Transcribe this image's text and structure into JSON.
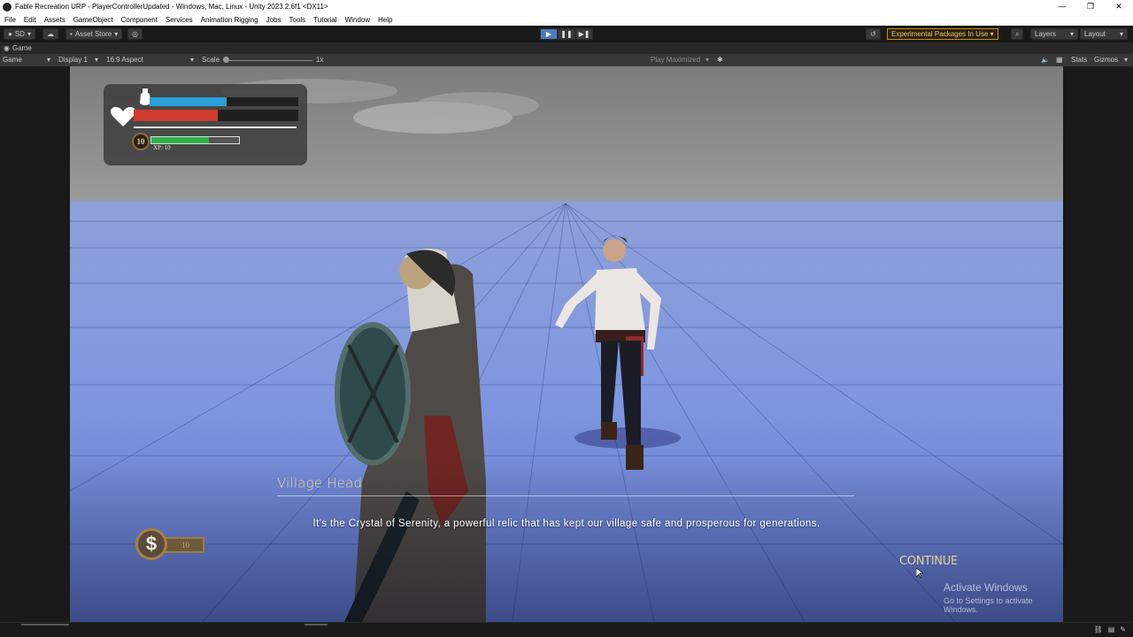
{
  "window": {
    "title": "Fable Recreation URP - PlayerControllerUpdated - Windows, Mac, Linux - Unity 2023.2.6f1 <DX11>",
    "controls": [
      "—",
      "❐",
      "✕"
    ]
  },
  "menu": [
    "File",
    "Edit",
    "Assets",
    "GameObject",
    "Component",
    "Services",
    "Animation Rigging",
    "Jobs",
    "Tools",
    "Tutorial",
    "Window",
    "Help"
  ],
  "toolbar": {
    "account": "SD",
    "asset_store": "Asset Store",
    "experimental": "Experimental Packages In Use",
    "layers": "Layers",
    "layout": "Layout",
    "play_controls": {
      "play": "▶",
      "pause": "❚❚",
      "step": "▶❚"
    }
  },
  "tab": {
    "label": "Game"
  },
  "game_bar": {
    "mode": "Game",
    "display": "Display 1",
    "aspect": "16:9 Aspect",
    "scale_label": "Scale",
    "scale_value": "1x",
    "play_mode": "Play Maximized",
    "stats": "Stats",
    "gizmos": "Gizmos"
  },
  "hud": {
    "mana_fraction": 0.52,
    "health_fraction": 0.51,
    "xp_fraction": 0.66,
    "level": "10",
    "xp_label": "XP: 10",
    "colors": {
      "mana": "#2a9fd8",
      "health": "#cf3b2f",
      "xp": "#2eb34a"
    }
  },
  "dialog": {
    "speaker": "Village Head",
    "text": "It's the Crystal of Serenity, a powerful relic that has kept our village safe and prosperous for generations.",
    "continue_label": "CONTINUE"
  },
  "currency": {
    "symbol": "$",
    "amount": "10"
  },
  "watermark": {
    "title": "Activate Windows",
    "subtitle": "Go to Settings to activate Windows."
  }
}
